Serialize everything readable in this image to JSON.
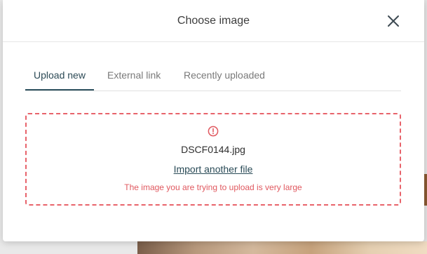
{
  "dialog": {
    "title": "Choose image",
    "close_icon": "close-icon"
  },
  "tabs": [
    {
      "label": "Upload new",
      "active": true
    },
    {
      "label": "External link",
      "active": false
    },
    {
      "label": "Recently uploaded",
      "active": false
    }
  ],
  "upload": {
    "status_icon": "alert-circle-icon",
    "file_name": "DSCF0144.jpg",
    "import_link": "Import another file",
    "error_message": "The image you are trying to upload is very large"
  },
  "colors": {
    "accent": "#2e5260",
    "error": "#e8636b",
    "error_text": "#e0585f"
  }
}
